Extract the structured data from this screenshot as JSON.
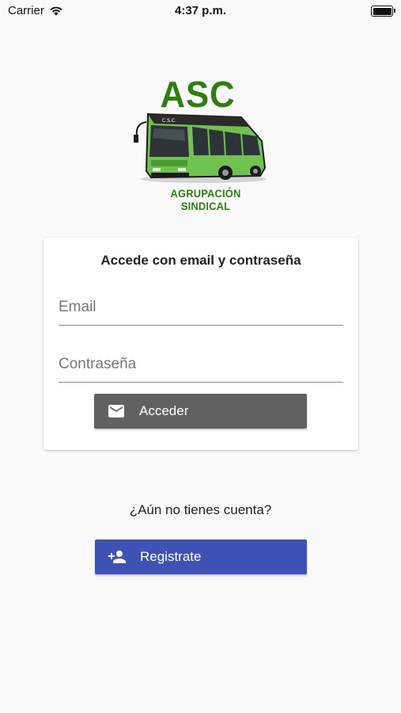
{
  "status_bar": {
    "carrier": "Carrier",
    "time": "4:37 p.m.",
    "battery_level": 1.0
  },
  "logo": {
    "title": "ASC",
    "subtitle": "AGRUPACIÓN SINDICAL",
    "bus_sign": "C.S.C.",
    "color": "#2f7d12"
  },
  "login_card": {
    "title": "Accede con email y contraseña",
    "email_placeholder": "Email",
    "email_value": "",
    "password_placeholder": "Contraseña",
    "password_value": "",
    "login_button": {
      "label": "Acceder",
      "icon": "mail-icon",
      "color": "#616161"
    }
  },
  "register": {
    "prompt": "¿Aún no tienes cuenta?",
    "button": {
      "label": "Registrate",
      "icon": "person-add-icon",
      "color": "#3f51b5"
    }
  }
}
